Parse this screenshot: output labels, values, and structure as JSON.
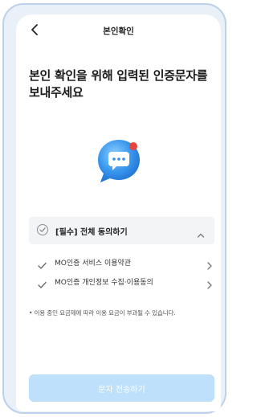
{
  "header": {
    "back_icon": "chevron-left-icon",
    "title": "본인확인"
  },
  "headline": "본인 확인을 위해 입력된 인증문자를 보내주세요",
  "illustration": {
    "icon": "chat-bubble-icon",
    "colors": {
      "bubble": "#2f8fe8",
      "notification_dot": "#e8463c"
    }
  },
  "agreement": {
    "all_label": "[필수] 전체 동의하기",
    "expanded": true,
    "terms": [
      {
        "label": "MO인증 서비스 이용약관"
      },
      {
        "label": "MO인증 개인정보 수집·이용동의"
      }
    ]
  },
  "notice": "• 이용 중인 요금제에 따라 이용 요금이 부과될 수 있습니다.",
  "cta": {
    "label": "문자 전송하기",
    "enabled": false,
    "color": "#bfe0fa"
  }
}
